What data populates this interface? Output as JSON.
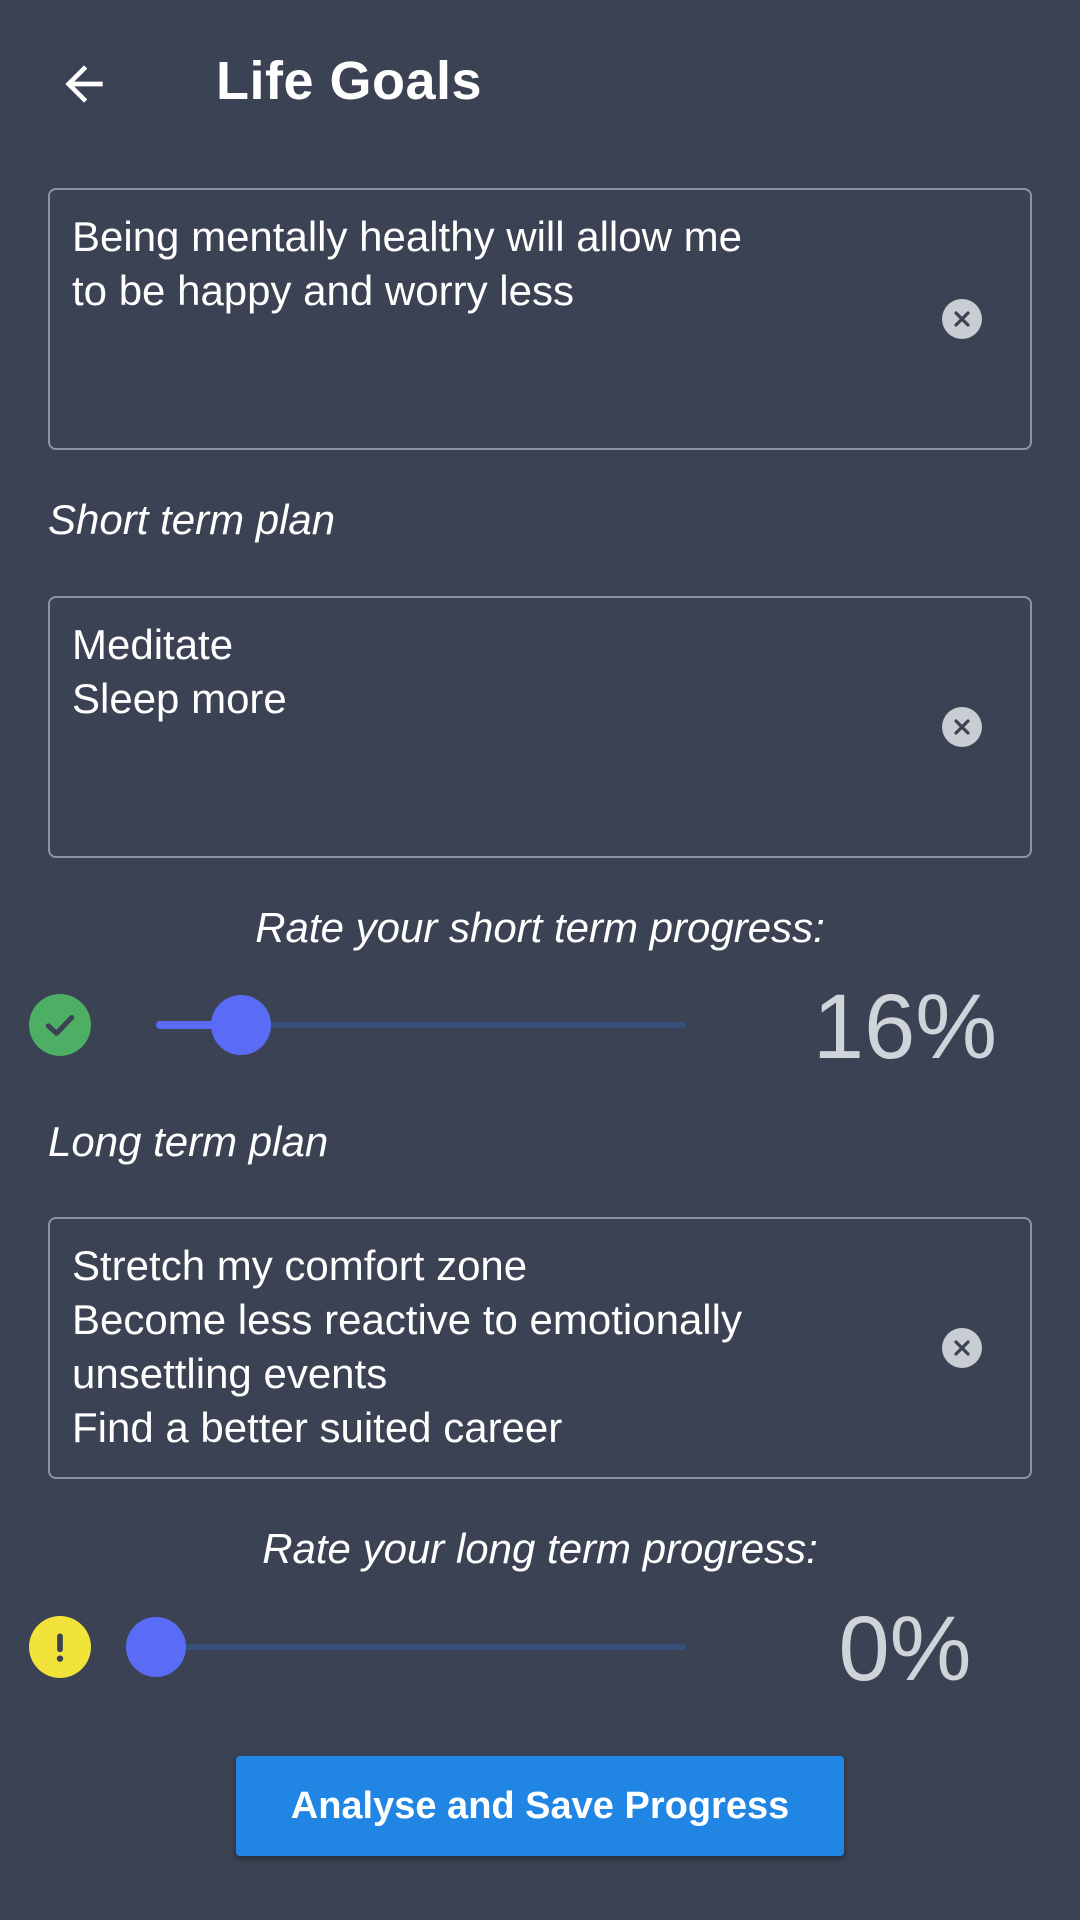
{
  "appbar": {
    "title": "Life Goals",
    "back_icon": "arrow-left-icon"
  },
  "motivation": {
    "value": "Being mentally healthy will allow me\nto be happy and worry less",
    "clear_icon": "clear-circle-icon"
  },
  "short_term": {
    "label": "Short term plan",
    "value": "Meditate\nSleep more",
    "rate_label": "Rate your short term progress:",
    "progress_percent": 16,
    "progress_text": "16%",
    "status_icon": "check-circle-icon",
    "status_color": "#4caf63"
  },
  "long_term": {
    "label": "Long term plan",
    "value": "Stretch my comfort zone\nBecome less reactive to emotionally\nunsettling events\nFind a better suited career",
    "rate_label": "Rate your long term progress:",
    "progress_percent": 0,
    "progress_text": "0%",
    "status_icon": "warning-circle-icon",
    "status_color": "#f2e33a"
  },
  "actions": {
    "save_label": "Analyse and Save Progress"
  },
  "colors": {
    "background": "#3b4253",
    "accent": "#5a6cf5",
    "button": "#2186e3"
  }
}
